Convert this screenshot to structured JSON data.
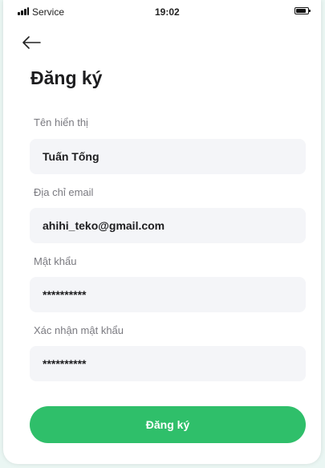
{
  "status_bar": {
    "carrier": "Service",
    "time": "19:02",
    "signal_icon": "signal-bars-icon",
    "battery_icon": "battery-icon"
  },
  "header": {
    "back_icon": "arrow-left-icon",
    "title": "Đăng ký"
  },
  "form": {
    "fields": [
      {
        "label": "Tên hiển thị",
        "value": "Tuấn Tống",
        "type": "text"
      },
      {
        "label": "Địa chỉ email",
        "value": "ahihi_teko@gmail.com",
        "type": "email"
      },
      {
        "label": "Mật khẩu",
        "value": "**********",
        "type": "text"
      },
      {
        "label": "Xác nhận mật khẩu",
        "value": "**********",
        "type": "text"
      }
    ],
    "submit_label": "Đăng ký"
  },
  "colors": {
    "accent": "#2fbf6a",
    "background": "#eaf6f3",
    "field_background": "#f4f5f8",
    "label": "#7a7a80",
    "text": "#1d1d1f"
  }
}
